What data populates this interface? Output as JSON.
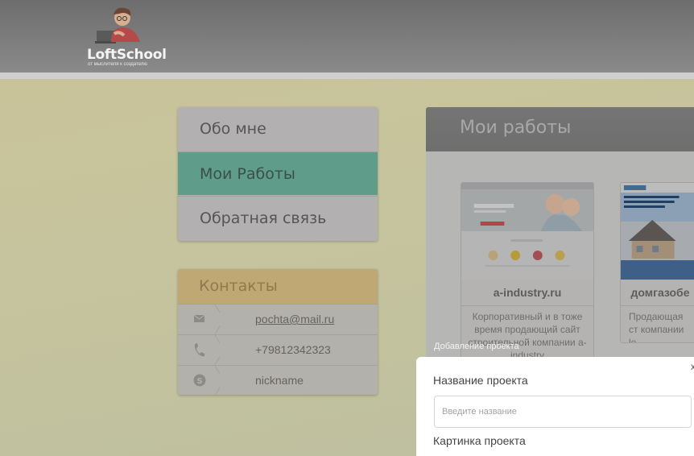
{
  "header": {
    "logo_text": "LoftSchool",
    "logo_subtext": "от мыслителя к создателю"
  },
  "nav": {
    "items": [
      {
        "label": "Обо мне",
        "active": false
      },
      {
        "label": "Мои Работы",
        "active": true
      },
      {
        "label": "Обратная связь",
        "active": false
      }
    ]
  },
  "contacts": {
    "title": "Контакты",
    "items": [
      {
        "icon": "mail-icon",
        "text": "pochta@mail.ru"
      },
      {
        "icon": "phone-icon",
        "text": "+79812342323"
      },
      {
        "icon": "skype-icon",
        "text": "nickname"
      }
    ]
  },
  "works": {
    "title": "Мои работы",
    "cards": [
      {
        "title": "a-industry.ru",
        "description": "Корпоративный и в тоже время продающий сайт строительной компании a-industry"
      },
      {
        "title": "домгазобе",
        "description": "Продающая ст компании le"
      }
    ]
  },
  "modal": {
    "caption": "Добавление проекта",
    "close_label": "x",
    "name_label": "Название проекта",
    "name_placeholder": "Введите название",
    "image_label": "Картинка проекта"
  },
  "colors": {
    "active_nav": "#5f9d8a",
    "contacts_header": "#c0a875",
    "header_bg": "#7a7a7a"
  }
}
